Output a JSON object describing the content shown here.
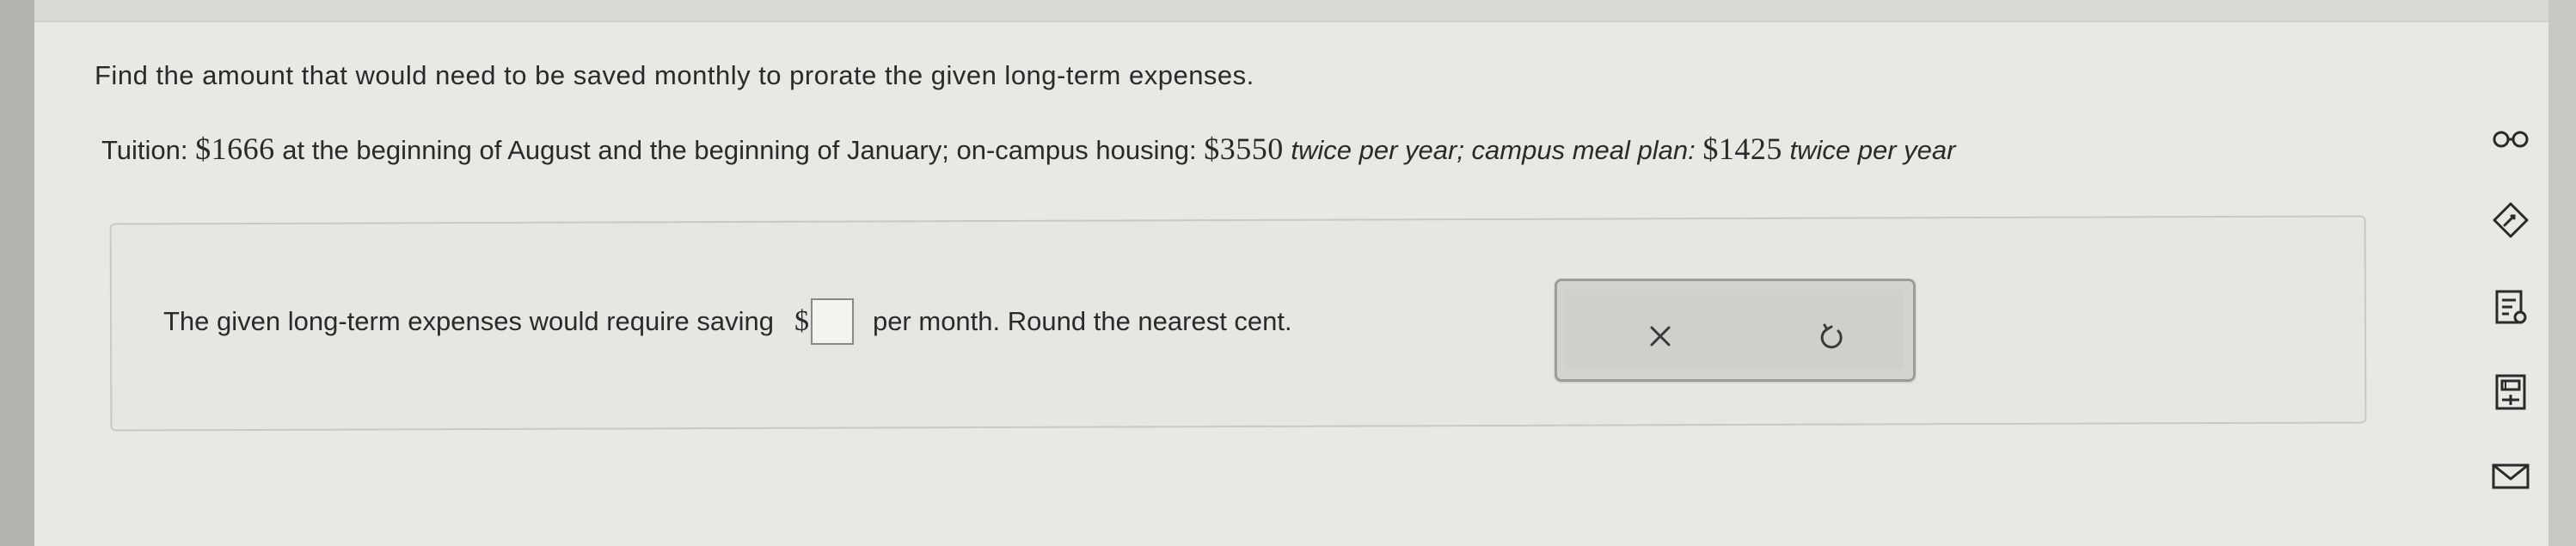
{
  "question": {
    "instruction": "Find the amount that would need to be saved monthly to prorate the given long-term expenses.",
    "tuition_label": "Tuition: ",
    "tuition_amount": "$1666",
    "tuition_text": " at the beginning of August and the beginning of January; on-campus housing: ",
    "housing_amount": "$3550",
    "housing_text": " twice per year; campus meal plan: ",
    "meal_amount": "$1425",
    "meal_text": " twice per year"
  },
  "answer": {
    "prefix": "The given long-term expenses would require saving",
    "currency": "$",
    "value": "",
    "suffix": "per month. Round the nearest cent."
  },
  "tools": {
    "clear_icon": "close-icon",
    "redo_icon": "redo-icon"
  },
  "sidebar": {
    "icons": [
      "glasses-icon",
      "edit-icon",
      "notes-icon",
      "calculator-icon",
      "mail-icon"
    ]
  }
}
